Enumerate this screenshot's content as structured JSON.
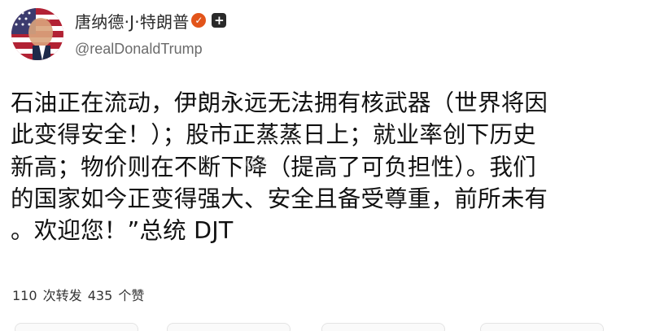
{
  "user": {
    "display_name": "唐纳德·J·特朗普",
    "handle": "@realDonaldTrump",
    "avatar_icon": "avatar-flag-portrait",
    "verified_icon": "verified-badge-icon",
    "follow_icon": "plus-icon"
  },
  "post": {
    "lines": [
      "石油正在流动，伊朗永远无法拥有核武器（世界将因",
      "此变得安全！）；股市正蒸蒸日上；就业率创下历史",
      "新高；物价则在不断下降（提高了可负担性）。我们",
      "的国家如今正变得强大、安全且备受尊重，前所未有",
      "。欢迎您！”总统 DJT"
    ]
  },
  "stats": {
    "reposts_count": "110",
    "reposts_label": "次转发",
    "likes_count": "435",
    "likes_label": "个赞"
  },
  "colors": {
    "badge": "#e2541a",
    "text": "#111111",
    "handle": "#6b6b6b"
  }
}
